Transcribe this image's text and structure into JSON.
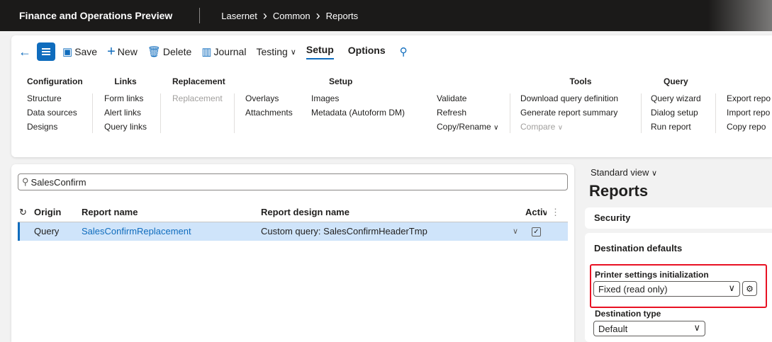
{
  "topbar": {
    "app_title": "Finance and Operations Preview",
    "breadcrumb": [
      "Lasernet",
      "Common",
      "Reports"
    ]
  },
  "toolbar": {
    "save": "Save",
    "new": "New",
    "delete": "Delete",
    "journal": "Journal",
    "testing": "Testing",
    "setup": "Setup",
    "options": "Options"
  },
  "ribbon": {
    "configuration": {
      "title": "Configuration",
      "items": [
        "Structure",
        "Data sources",
        "Designs"
      ]
    },
    "links": {
      "title": "Links",
      "items": [
        "Form links",
        "Alert links",
        "Query links"
      ]
    },
    "replacement": {
      "title": "Replacement",
      "items": [
        "Replacement"
      ]
    },
    "setup": {
      "title": "Setup",
      "col1": [
        "Overlays",
        "Attachments"
      ],
      "col2": [
        "Images",
        "Metadata (Autoform DM)"
      ],
      "col3": [
        "Validate",
        "Refresh",
        "Copy/Rename"
      ]
    },
    "tools": {
      "title": "Tools",
      "items": [
        "Download query definition",
        "Generate report summary",
        "Compare"
      ]
    },
    "query": {
      "title": "Query",
      "items": [
        "Query wizard",
        "Dialog setup",
        "Run report"
      ]
    },
    "more": {
      "items": [
        "Export repo",
        "Import repo",
        "Copy repo"
      ]
    }
  },
  "list": {
    "search_value": "SalesConfirm",
    "columns": [
      "Origin",
      "Report name",
      "Report design name",
      "Activ"
    ],
    "rows": [
      {
        "origin": "Query",
        "report_name": "SalesConfirmReplacement",
        "design_name": "Custom query: SalesConfirmHeaderTmp"
      }
    ]
  },
  "details": {
    "view": "Standard view",
    "title": "Reports",
    "security": "Security",
    "destination_defaults": "Destination defaults",
    "printer_label": "Printer settings initialization",
    "printer_value": "Fixed (read only)",
    "dest_type_label": "Destination type",
    "dest_type_value": "Default"
  },
  "colors": {
    "accent": "#0f6cbd",
    "highlight": "#e81123",
    "selected_row": "#cfe4fa"
  }
}
